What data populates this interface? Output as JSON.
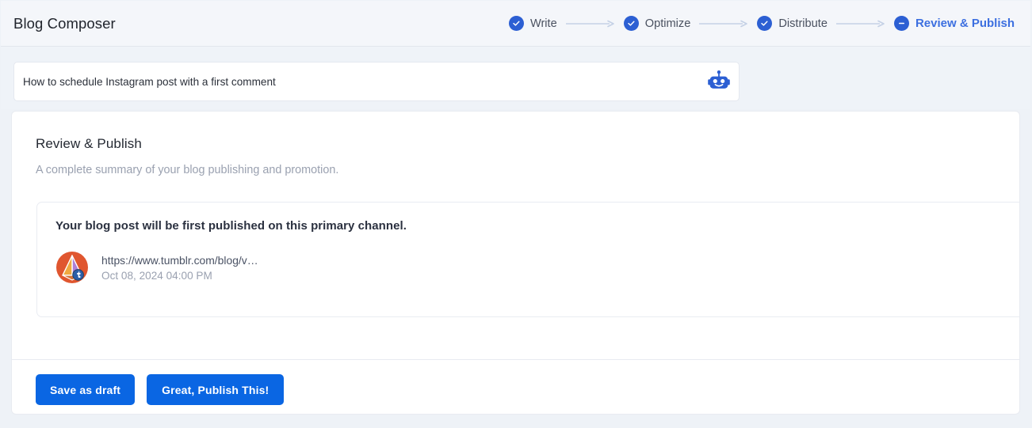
{
  "header": {
    "app_title": "Blog Composer",
    "stepper": [
      {
        "label": "Write",
        "state": "complete",
        "icon": "check-icon"
      },
      {
        "label": "Optimize",
        "state": "complete",
        "icon": "check-icon"
      },
      {
        "label": "Distribute",
        "state": "complete",
        "icon": "check-icon"
      },
      {
        "label": "Review & Publish",
        "state": "active",
        "icon": "minus-icon"
      }
    ]
  },
  "title_bar": {
    "value": "How to schedule Instagram post with a first comment",
    "placeholder": "Enter your blog title",
    "assistant_icon": "robot-icon"
  },
  "main": {
    "section_title": "Review & Publish",
    "section_subtitle": "A complete summary of your blog publishing and promotion.",
    "primary_channel": {
      "heading": "Your blog post will be first published on this primary channel.",
      "avatar_icon": "tumblr-avatar-icon",
      "url": "https://www.tumblr.com/blog/v…",
      "scheduled_at": "Oct 08, 2024 04:00 PM"
    }
  },
  "footer": {
    "save_draft_label": "Save as draft",
    "publish_label": "Great, Publish This!"
  },
  "colors": {
    "accent_blue": "#0a66e3",
    "step_blue": "#2c5fd3",
    "active_label_blue": "#3c6fe0",
    "header_bg": "#f4f6fa",
    "strip_bg": "#eff3f8",
    "page_bg": "#eef2f7",
    "muted_text": "#9aa1b0"
  }
}
